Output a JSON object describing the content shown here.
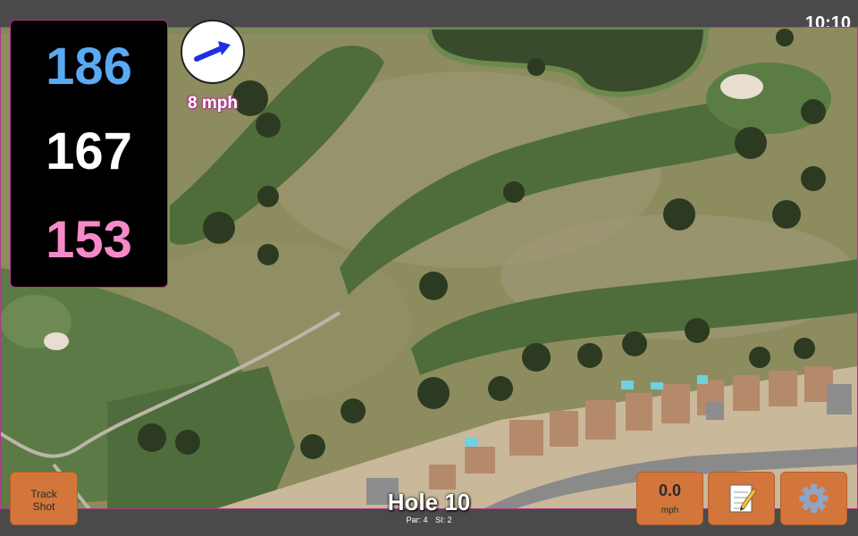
{
  "status_bar": {
    "time": "10:10"
  },
  "distances": {
    "back": "186",
    "middle": "167",
    "front": "153",
    "colors": {
      "back": "#5aa9f2",
      "middle": "#ffffff",
      "front": "#f58ac8"
    }
  },
  "wind": {
    "speed_label": "8 mph",
    "arrow_icon": "wind-direction-arrow-icon",
    "arrow_color": "#1f2fe0"
  },
  "buttons": {
    "track_shot": {
      "line1": "Track",
      "line2": "Shot"
    },
    "wind_readout": {
      "value": "0.0",
      "unit": "mph"
    },
    "notes_icon": "notepad-icon",
    "settings_icon": "gear-icon",
    "accent": "#d2763c"
  },
  "hole": {
    "title": "Hole 10",
    "par": "Par: 4",
    "si": "SI: 2"
  },
  "map": {
    "type": "satellite-golf-course"
  }
}
